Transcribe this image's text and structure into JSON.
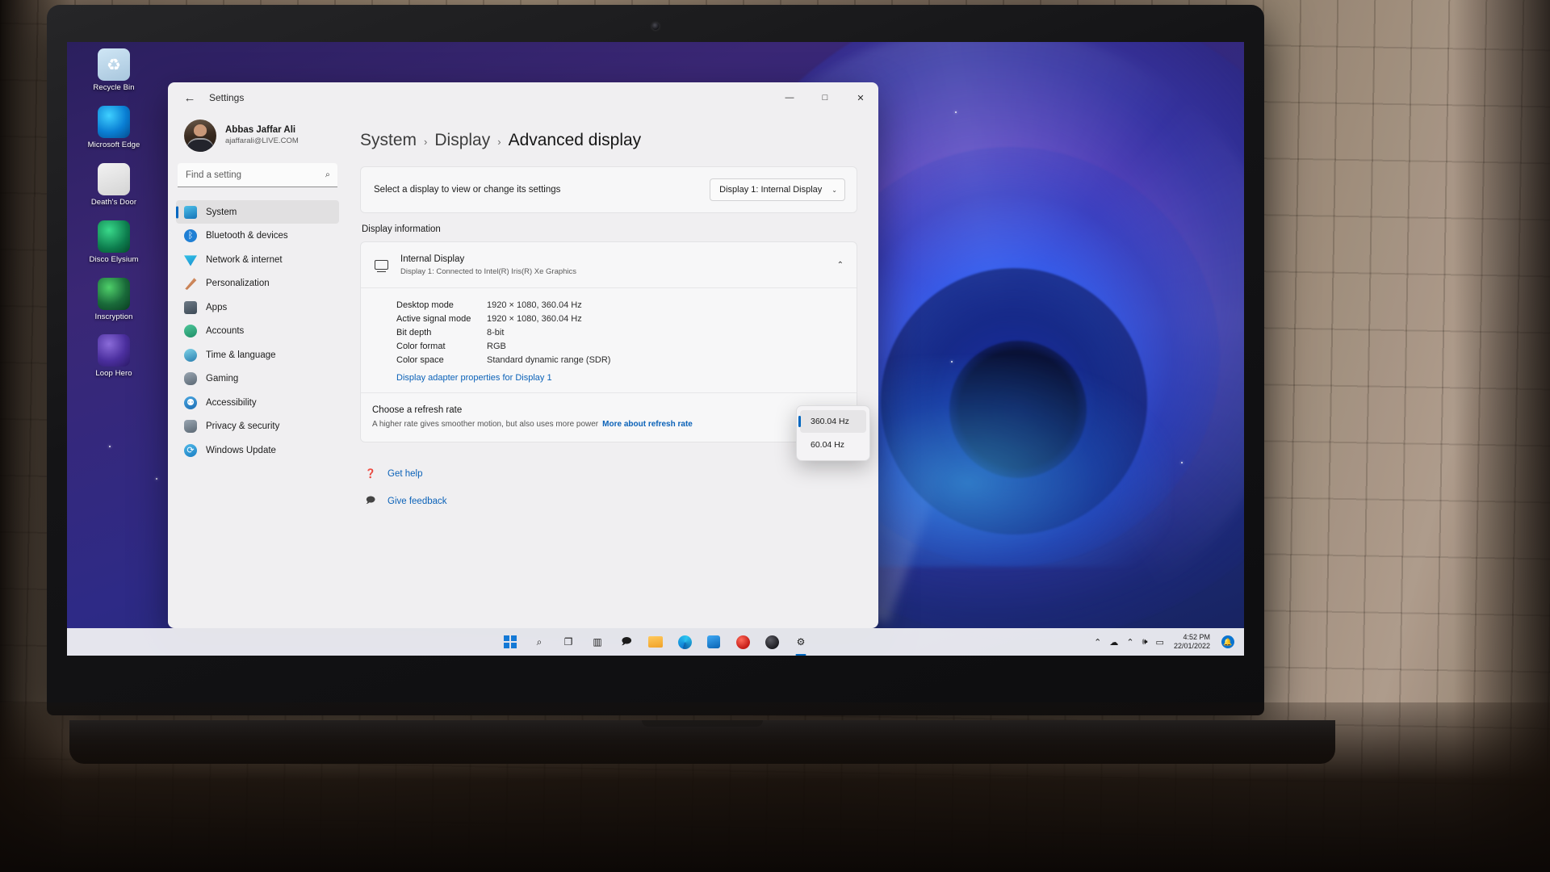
{
  "window": {
    "title": "Settings",
    "back_icon": "←",
    "minimize": "—",
    "maximize": "□",
    "close": "✕"
  },
  "account": {
    "name": "Abbas Jaffar Ali",
    "email": "ajaffarali@LIVE.COM"
  },
  "search": {
    "placeholder": "Find a setting",
    "icon": "search-icon"
  },
  "sidebar": {
    "items": [
      {
        "label": "System",
        "icon": "system-icon",
        "active": true
      },
      {
        "label": "Bluetooth & devices",
        "icon": "bluetooth-icon",
        "active": false
      },
      {
        "label": "Network & internet",
        "icon": "network-icon",
        "active": false
      },
      {
        "label": "Personalization",
        "icon": "brush-icon",
        "active": false
      },
      {
        "label": "Apps",
        "icon": "apps-icon",
        "active": false
      },
      {
        "label": "Accounts",
        "icon": "account-icon",
        "active": false
      },
      {
        "label": "Time & language",
        "icon": "clock-icon",
        "active": false
      },
      {
        "label": "Gaming",
        "icon": "gamepad-icon",
        "active": false
      },
      {
        "label": "Accessibility",
        "icon": "accessibility-icon",
        "active": false
      },
      {
        "label": "Privacy & security",
        "icon": "shield-icon",
        "active": false
      },
      {
        "label": "Windows Update",
        "icon": "update-icon",
        "active": false
      }
    ]
  },
  "breadcrumb": {
    "root": "System",
    "sep1": "›",
    "parent": "Display",
    "sep2": "›",
    "current": "Advanced display"
  },
  "display_select": {
    "label": "Select a display to view or change its settings",
    "value": "Display 1: Internal Display",
    "chevron": "⌄"
  },
  "display_information": {
    "section_title": "Display information",
    "monitor_name": "Internal Display",
    "monitor_sub": "Display 1: Connected to Intel(R) Iris(R) Xe Graphics",
    "collapse_chevron": "⌃",
    "specs": [
      {
        "key": "Desktop mode",
        "value": "1920 × 1080, 360.04 Hz"
      },
      {
        "key": "Active signal mode",
        "value": "1920 × 1080, 360.04 Hz"
      },
      {
        "key": "Bit depth",
        "value": "8-bit"
      },
      {
        "key": "Color format",
        "value": "RGB"
      },
      {
        "key": "Color space",
        "value": "Standard dynamic range (SDR)"
      }
    ],
    "adapter_link": "Display adapter properties for Display 1"
  },
  "refresh_rate": {
    "title": "Choose a refresh rate",
    "subtitle": "A higher rate gives smoother motion, but also uses more power",
    "link": "More about refresh rate",
    "options": [
      {
        "label": "360.04 Hz",
        "selected": true
      },
      {
        "label": "60.04 Hz",
        "selected": false
      }
    ]
  },
  "footer": {
    "get_help": "Get help",
    "get_help_icon": "help-icon",
    "give_feedback": "Give feedback",
    "give_feedback_icon": "feedback-icon"
  },
  "desktop_icons": [
    {
      "label": "Recycle Bin",
      "icon": "recycle-bin-icon",
      "glyph": "♻"
    },
    {
      "label": "Microsoft Edge",
      "icon": "edge-icon",
      "glyph": ""
    },
    {
      "label": "Death's Door",
      "icon": "deaths-door-icon",
      "glyph": ""
    },
    {
      "label": "Disco Elysium",
      "icon": "disco-elysium-icon",
      "glyph": ""
    },
    {
      "label": "Inscryption",
      "icon": "inscryption-icon",
      "glyph": ""
    },
    {
      "label": "Loop Hero",
      "icon": "loop-hero-icon",
      "glyph": ""
    }
  ],
  "taskbar": {
    "items": [
      {
        "name": "start-button",
        "icon": "windows-logo-icon"
      },
      {
        "name": "search-button",
        "icon": "search-icon",
        "glyph": "🔍"
      },
      {
        "name": "task-view-button",
        "icon": "task-view-icon",
        "glyph": "🗖"
      },
      {
        "name": "widgets-button",
        "icon": "widgets-icon",
        "glyph": "▥"
      },
      {
        "name": "chat-button",
        "icon": "chat-icon",
        "glyph": "💬"
      },
      {
        "name": "file-explorer-button",
        "icon": "folder-icon",
        "glyph": ""
      },
      {
        "name": "edge-button",
        "icon": "edge-icon",
        "glyph": ""
      },
      {
        "name": "store-button",
        "icon": "store-icon",
        "glyph": ""
      },
      {
        "name": "opera-button",
        "icon": "opera-icon",
        "glyph": ""
      },
      {
        "name": "xbox-button",
        "icon": "xbox-icon",
        "glyph": "✖"
      },
      {
        "name": "settings-button",
        "icon": "settings-gear-icon",
        "glyph": "⚙"
      }
    ],
    "tray": {
      "chevron": "⌃",
      "onedrive": "☁",
      "wifi": "📶",
      "volume": "🔊",
      "battery": "🔋",
      "time": "4:52 PM",
      "date": "22/01/2022",
      "notification": "🔔"
    }
  },
  "colors": {
    "accent": "#0067c0",
    "link": "#0b62b8",
    "window_bg": "#f0eff1",
    "card_bg": "#f7f7f8"
  }
}
